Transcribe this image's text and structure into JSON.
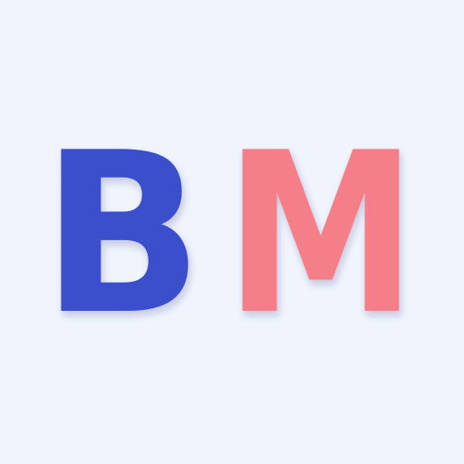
{
  "logo": {
    "letter_b": "B",
    "letter_m": "M",
    "color_b": "#3A4FCC",
    "color_m": "#F57F88",
    "background": "#EFF4FD"
  }
}
